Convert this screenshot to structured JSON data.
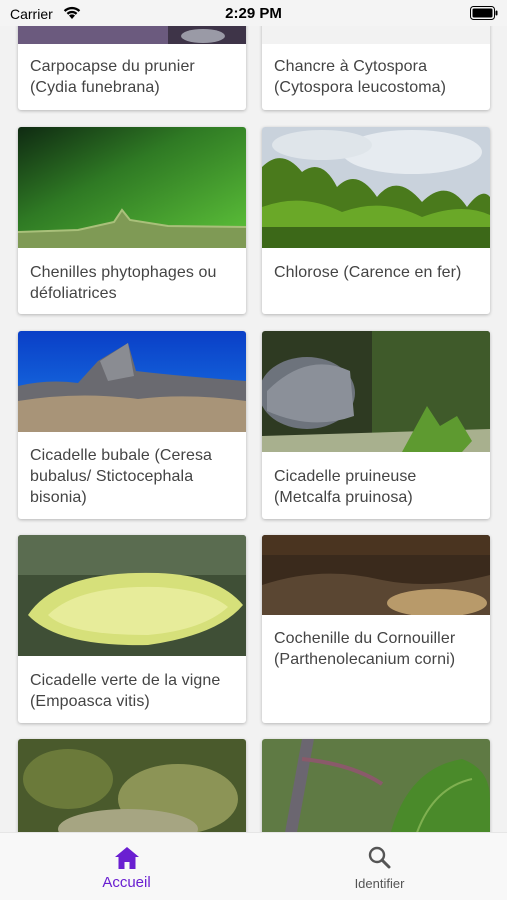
{
  "status_bar": {
    "carrier": "Carrier",
    "time": "2:29 PM"
  },
  "cards": [
    {
      "title": "Carpocapse du prunier (Cydia funebrana)"
    },
    {
      "title": "Chancre à Cytospora (Cytospora leucostoma)"
    },
    {
      "title": "Chenilles phytophages ou défoliatrices"
    },
    {
      "title": "Chlorose (Carence en fer)"
    },
    {
      "title": "Cicadelle bubale (Ceresa bubalus/ Stictocephala bisonia)"
    },
    {
      "title": "Cicadelle pruineuse (Metcalfa pruinosa)"
    },
    {
      "title": "Cicadelle verte de la vigne (Empoasca vitis)"
    },
    {
      "title": "Cochenille du Cornouiller (Parthenolecanium corni)"
    }
  ],
  "bottom_nav": {
    "items": [
      {
        "label": "Accueil",
        "icon": "home-icon",
        "active": true
      },
      {
        "label": "Identifier",
        "icon": "search-icon",
        "active": false
      }
    ],
    "accent_color": "#6a1fd1"
  }
}
